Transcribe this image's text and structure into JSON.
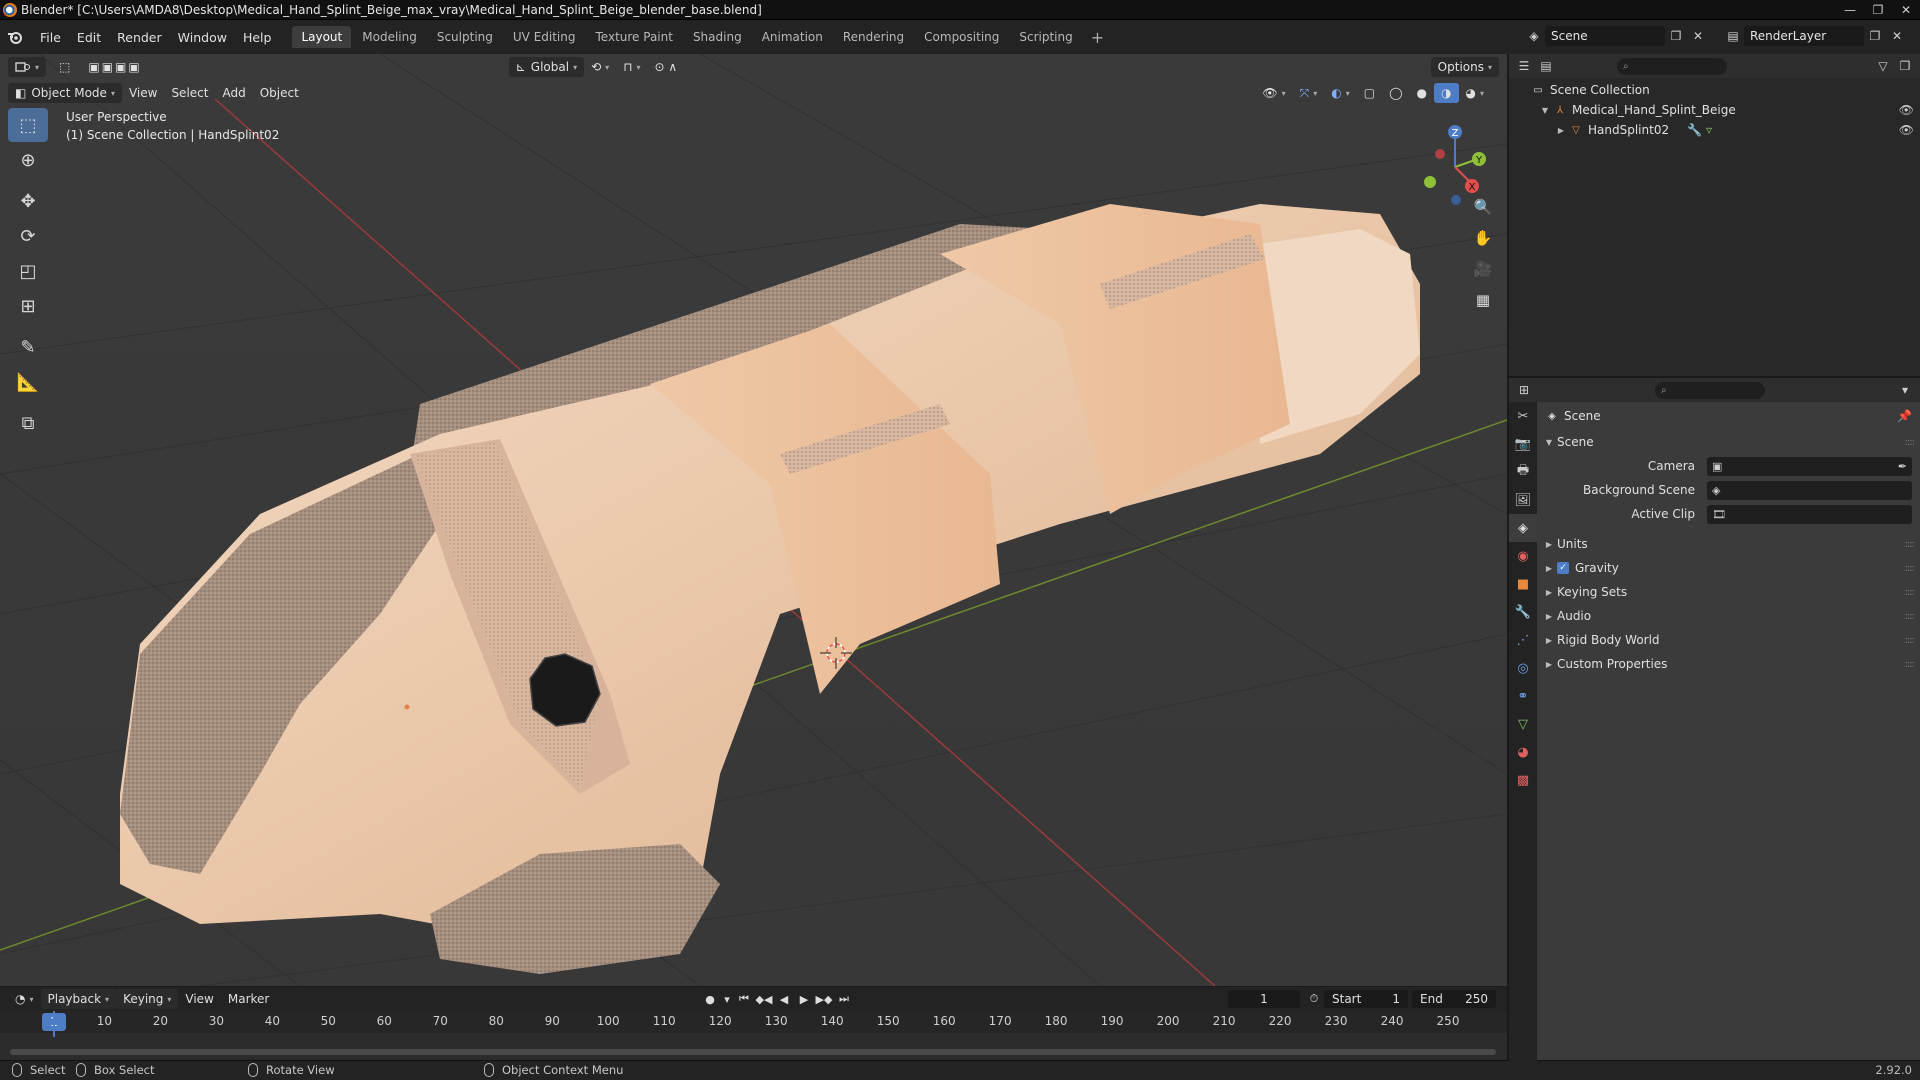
{
  "window": {
    "title": "Blender* [C:\\Users\\AMDA8\\Desktop\\Medical_Hand_Splint_Beige_max_vray\\Medical_Hand_Splint_Beige_blender_base.blend]",
    "minimize": "—",
    "maximize": "❐",
    "close": "✕"
  },
  "menu": [
    "File",
    "Edit",
    "Render",
    "Window",
    "Help"
  ],
  "workspaces": [
    "Layout",
    "Modeling",
    "Sculpting",
    "UV Editing",
    "Texture Paint",
    "Shading",
    "Animation",
    "Rendering",
    "Compositing",
    "Scripting"
  ],
  "active_workspace": "Layout",
  "tab_add": "+",
  "scene": {
    "name": "Scene",
    "render_layer": "RenderLayer"
  },
  "viewport": {
    "mode": "Object Mode",
    "menus": [
      "View",
      "Select",
      "Add",
      "Object"
    ],
    "transform_orientation": "Global",
    "options": "Options",
    "perspective_label": "User Perspective",
    "collection_label": "(1) Scene Collection | HandSplint02",
    "gizmo_axes": {
      "x": "X",
      "y": "Y",
      "z": "Z"
    }
  },
  "icons": {
    "tools": [
      "select-box-icon",
      "cursor-icon",
      "move-icon",
      "rotate-icon",
      "scale-icon",
      "transform-icon",
      "annotate-icon",
      "measure-icon",
      "add-cube-icon"
    ],
    "nav": [
      "zoom-icon",
      "pan-hand-icon",
      "camera-view-icon",
      "grid-view-icon"
    ]
  },
  "timeline": {
    "menus": [
      "Playback",
      "Keying",
      "View",
      "Marker"
    ],
    "current_frame": "1",
    "start_label": "Start",
    "start": "1",
    "end_label": "End",
    "end": "250",
    "ticks": [
      "1",
      "10",
      "20",
      "30",
      "40",
      "50",
      "60",
      "70",
      "80",
      "90",
      "100",
      "110",
      "120",
      "130",
      "140",
      "150",
      "160",
      "170",
      "180",
      "190",
      "200",
      "210",
      "220",
      "230",
      "240",
      "250"
    ]
  },
  "status": {
    "select": "Select",
    "box_select": "Box Select",
    "rotate_view": "Rotate View",
    "context_menu": "Object Context Menu",
    "version": "2.92.0"
  },
  "outliner": {
    "root": "Scene Collection",
    "collection": "Medical_Hand_Splint_Beige",
    "object": "HandSplint02"
  },
  "properties": {
    "context": "Scene",
    "panel": "Scene",
    "fields": [
      {
        "label": "Camera",
        "value": ""
      },
      {
        "label": "Background Scene",
        "value": ""
      },
      {
        "label": "Active Clip",
        "value": ""
      }
    ],
    "sections": [
      "Units",
      "Gravity",
      "Keying Sets",
      "Audio",
      "Rigid Body World",
      "Custom Properties"
    ]
  },
  "colors": {
    "accent": "#4d7dc6",
    "splint_beige": "#e8c6a8",
    "viewport_bg": "#393939"
  }
}
